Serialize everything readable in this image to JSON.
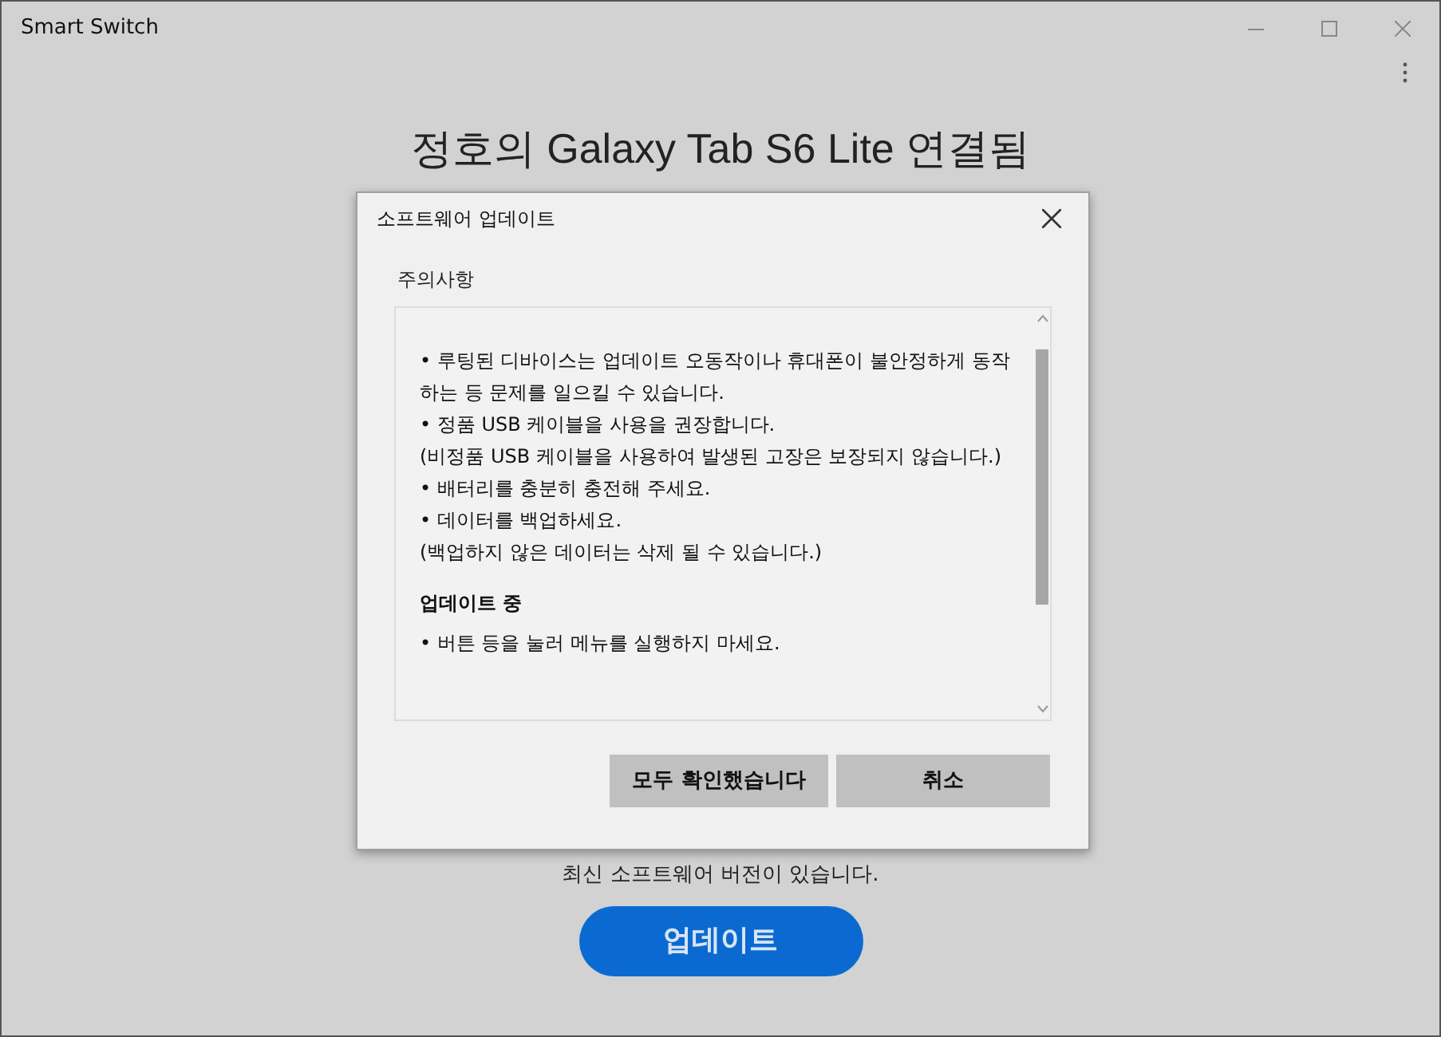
{
  "window": {
    "title": "Smart Switch"
  },
  "main": {
    "heading": "정호의 Galaxy Tab S6 Lite 연결됨",
    "status": "최신 소프트웨어 버전이 있습니다.",
    "update_button": "업데이트"
  },
  "dialog": {
    "title": "소프트웨어 업데이트",
    "section_label": "주의사항",
    "content": [
      {
        "kind": "bullet",
        "text": "• 루팅된 디바이스는 업데이트 오동작이나 휴대폰이 불안정하게 동작하는 등 문제를 일으킬 수 있습니다."
      },
      {
        "kind": "bullet",
        "text": "• 정품 USB 케이블을 사용을 권장합니다."
      },
      {
        "kind": "note",
        "text": "(비정품 USB 케이블을 사용하여 발생된 고장은 보장되지 않습니다.)"
      },
      {
        "kind": "bullet",
        "text": "• 배터리를 충분히 충전해 주세요."
      },
      {
        "kind": "bullet",
        "text": "• 데이터를 백업하세요."
      },
      {
        "kind": "note",
        "text": "(백업하지 않은 데이터는 삭제 될 수 있습니다.)"
      },
      {
        "kind": "heading",
        "text": "업데이트 중"
      },
      {
        "kind": "bullet",
        "text": "• 버튼 등을 눌러 메뉴를 실행하지 마세요."
      }
    ],
    "buttons": [
      "모두 확인했습니다",
      "취소"
    ]
  }
}
